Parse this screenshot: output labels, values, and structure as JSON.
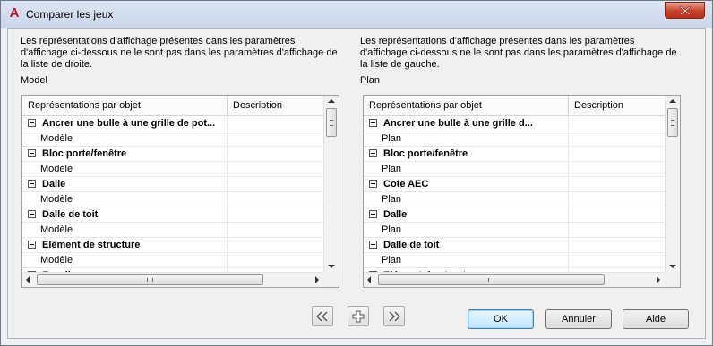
{
  "window": {
    "title": "Comparer les jeux"
  },
  "left": {
    "description": "Les représentations d'affichage présentes dans les paramètres d'affichage ci-dessous ne le sont pas dans les paramètres d'affichage de la liste de droite.",
    "set_name": "Model",
    "columns": [
      "Représentations par objet",
      "Description"
    ],
    "rows": [
      {
        "type": "group",
        "text": "Ancrer une bulle à une grille de pot..."
      },
      {
        "type": "child",
        "text": "Modèle"
      },
      {
        "type": "group",
        "text": "Bloc porte/fenêtre"
      },
      {
        "type": "child",
        "text": "Modèle"
      },
      {
        "type": "group",
        "text": "Dalle"
      },
      {
        "type": "child",
        "text": "Modèle"
      },
      {
        "type": "group",
        "text": "Dalle de toit"
      },
      {
        "type": "child",
        "text": "Modèle"
      },
      {
        "type": "group",
        "text": "Elément de structure"
      },
      {
        "type": "child",
        "text": "Modèle"
      },
      {
        "type": "group",
        "text": "Escalier"
      }
    ]
  },
  "right": {
    "description": "Les représentations d'affichage présentes dans les paramètres d'affichage ci-dessous ne le sont pas dans les paramètres d'affichage de la liste de gauche.",
    "set_name": "Plan",
    "columns": [
      "Représentations par objet",
      "Description"
    ],
    "rows": [
      {
        "type": "group",
        "text": "Ancrer une bulle à une grille d..."
      },
      {
        "type": "child",
        "text": "Plan"
      },
      {
        "type": "group",
        "text": "Bloc porte/fenêtre"
      },
      {
        "type": "child",
        "text": "Plan"
      },
      {
        "type": "group",
        "text": "Cote AEC"
      },
      {
        "type": "child",
        "text": "Plan"
      },
      {
        "type": "group",
        "text": "Dalle"
      },
      {
        "type": "child",
        "text": "Plan"
      },
      {
        "type": "group",
        "text": "Dalle de toit"
      },
      {
        "type": "child",
        "text": "Plan"
      },
      {
        "type": "group",
        "text": "Elément de structure"
      }
    ]
  },
  "buttons": {
    "ok": "OK",
    "cancel": "Annuler",
    "help": "Aide"
  },
  "icons": {
    "move_left": "double-chevron-left-icon",
    "add": "plus-icon",
    "move_right": "double-chevron-right-icon",
    "close": "close-icon",
    "app": "autocad-icon"
  },
  "colors": {
    "close_button": "#c7402b",
    "app_icon": "#c0102a"
  }
}
